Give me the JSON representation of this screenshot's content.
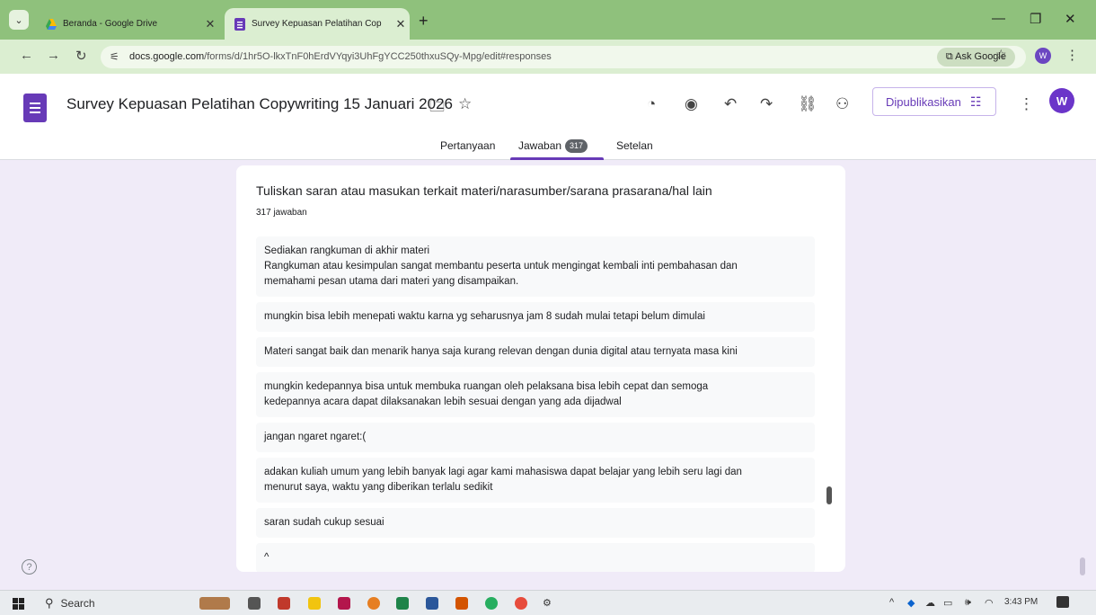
{
  "browser": {
    "tabs": [
      {
        "title": "Beranda - Google Drive",
        "active": false
      },
      {
        "title": "Survey Kepuasan Pelatihan Cop",
        "active": true
      }
    ],
    "new_tab_icon": "plus-icon",
    "address": {
      "host": "docs.google.com",
      "path": "/forms/d/1hr5O-lkxTnF0hErdVYqyi3UhFgYCC250thxuSQy-Mpg/edit#responses"
    },
    "ask_google_label": "Ask Google",
    "profile_initial": "W"
  },
  "form": {
    "title": "Survey Kepuasan Pelatihan Copywriting 15 Januari 2026",
    "publish_label": "Dipublikasikan",
    "avatar_initial": "W",
    "tabs": {
      "questions": "Pertanyaan",
      "responses": "Jawaban",
      "responses_count": "317",
      "settings": "Setelan"
    },
    "accent_color": "#673ab7"
  },
  "question": {
    "title": "Tuliskan saran atau masukan terkait materi/narasumber/sarana prasarana/hal lain",
    "count": "317 jawaban",
    "responses": [
      [
        "Sediakan rangkuman di akhir materi",
        "Rangkuman atau kesimpulan sangat membantu peserta untuk mengingat kembali inti pembahasan dan",
        "memahami pesan utama dari materi yang disampaikan."
      ],
      [
        "mungkin bisa lebih menepati waktu karna yg seharusnya jam 8 sudah mulai tetapi belum dimulai"
      ],
      [
        "Materi sangat baik dan menarik hanya saja kurang relevan dengan dunia digital atau ternyata masa kini"
      ],
      [
        "mungkin kedepannya bisa untuk membuka ruangan oleh pelaksana bisa lebih cepat dan semoga",
        "kedepannya acara dapat dilaksanakan lebih sesuai dengan yang ada dijadwal"
      ],
      [
        "jangan ngaret ngaret:("
      ],
      [
        "adakan kuliah umum yang lebih banyak lagi agar kami mahasiswa dapat belajar yang lebih seru lagi dan",
        "menurut saya, waktu yang diberikan terlalu sedikit"
      ],
      [
        "saran sudah cukup sesuai"
      ],
      [
        "^"
      ]
    ]
  },
  "taskbar": {
    "search_label": "Search",
    "clock": "3:43 PM"
  }
}
